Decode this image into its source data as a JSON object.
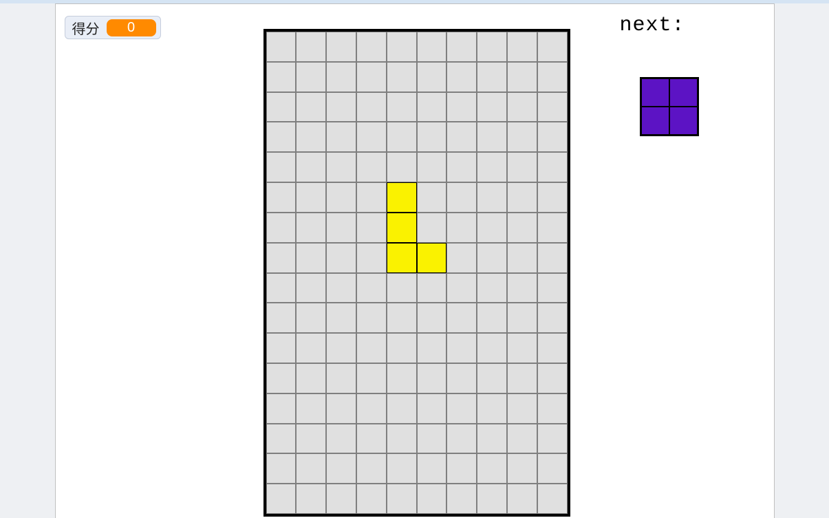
{
  "score": {
    "label": "得分",
    "value": "0"
  },
  "next": {
    "label": "next:",
    "piece": {
      "type": "O",
      "color": "#5c13c4",
      "rows": 2,
      "cols": 2,
      "cells": [
        [
          0,
          0
        ],
        [
          0,
          1
        ],
        [
          1,
          0
        ],
        [
          1,
          1
        ]
      ]
    }
  },
  "board": {
    "rows": 16,
    "cols": 10,
    "empty_color": "#e0e0e0",
    "active_piece": {
      "type": "J",
      "color": "#faf200",
      "cells": [
        [
          5,
          4
        ],
        [
          6,
          4
        ],
        [
          7,
          4
        ],
        [
          7,
          5
        ]
      ]
    }
  }
}
